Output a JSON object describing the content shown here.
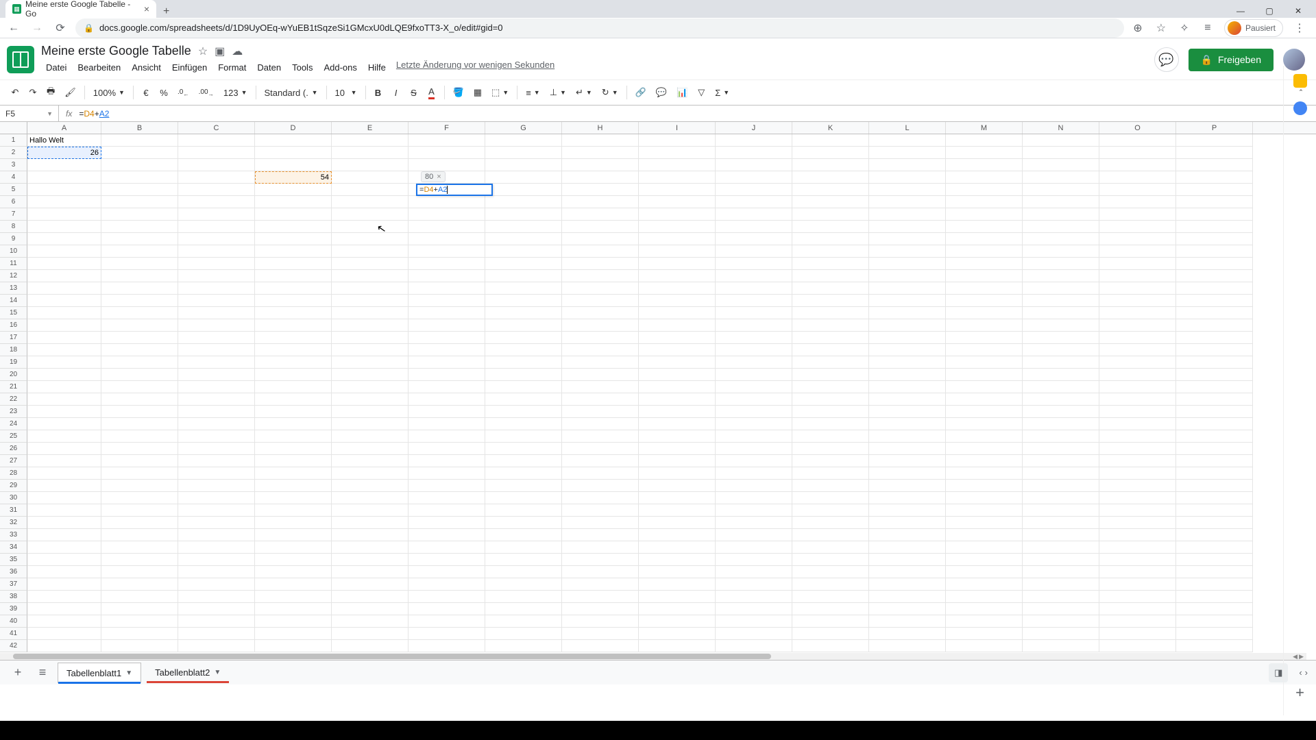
{
  "browser": {
    "tab_title": "Meine erste Google Tabelle - Go",
    "url": "docs.google.com/spreadsheets/d/1D9UyOEq-wYuEB1tSqzeSi1GMcxU0dLQE9fxoTT3-X_o/edit#gid=0",
    "profile_status": "Pausiert"
  },
  "doc": {
    "title": "Meine erste Google Tabelle",
    "last_edit": "Letzte Änderung vor wenigen Sekunden",
    "share_label": "Freigeben"
  },
  "menus": {
    "file": "Datei",
    "edit": "Bearbeiten",
    "view": "Ansicht",
    "insert": "Einfügen",
    "format": "Format",
    "data": "Daten",
    "tools": "Tools",
    "addons": "Add-ons",
    "help": "Hilfe"
  },
  "toolbar": {
    "zoom": "100%",
    "currency": "€",
    "percent": "%",
    "dec_dec": ".0",
    "inc_dec": ".00",
    "num_format": "123",
    "font": "Standard (...",
    "size": "10"
  },
  "fx": {
    "name_box": "F5",
    "formula_eq": "=",
    "formula_ref1": "D4",
    "formula_plus": "+",
    "formula_ref2": "A2"
  },
  "cells": {
    "A1": "Hallo Welt",
    "A2": "26",
    "D4": "54"
  },
  "editor": {
    "eq": "=",
    "ref1": "D4",
    "plus": "+",
    "ref2": "A2",
    "preview": "80"
  },
  "columns": [
    "A",
    "B",
    "C",
    "D",
    "E",
    "F",
    "G",
    "H",
    "I",
    "J",
    "K",
    "L",
    "M",
    "N",
    "O",
    "P"
  ],
  "sheets": {
    "active": "Tabellenblatt1",
    "other": "Tabellenblatt2"
  }
}
